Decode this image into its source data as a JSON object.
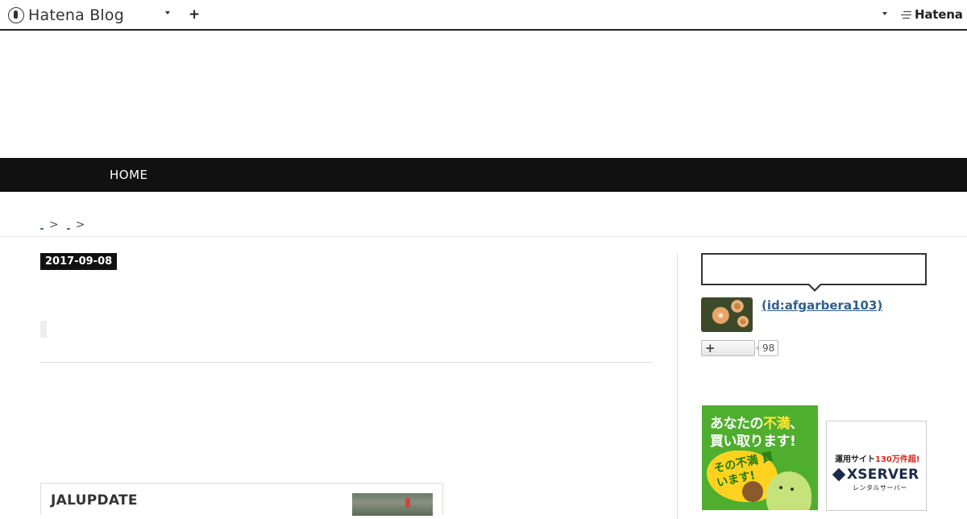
{
  "header": {
    "logo_text": "Hatena Blog",
    "add_icon": "+",
    "brand_text": "Hatena"
  },
  "nav": {
    "home_label": "HOME"
  },
  "breadcrumb": {
    "separator_1": ">",
    "separator_2": ">"
  },
  "article": {
    "date": "2017-09-08",
    "embed_title": "JALUPDATE"
  },
  "sidebar": {
    "user_id_text": " (id:afgarbera103)",
    "follow_icon": "+",
    "follower_count": "98"
  },
  "ads": {
    "ad1_line1_part1": "あなたの",
    "ad1_line1_accent": "不満",
    "ad1_line1_part2": "、",
    "ad1_line2": "買い取ります!",
    "ad1_burst": "その不満 買います!",
    "ad2_top_part1": "運用サイト",
    "ad2_top_red": "130万件超!",
    "ad2_brand": "XSERVER",
    "ad2_sub": "レンタルサーバー"
  }
}
